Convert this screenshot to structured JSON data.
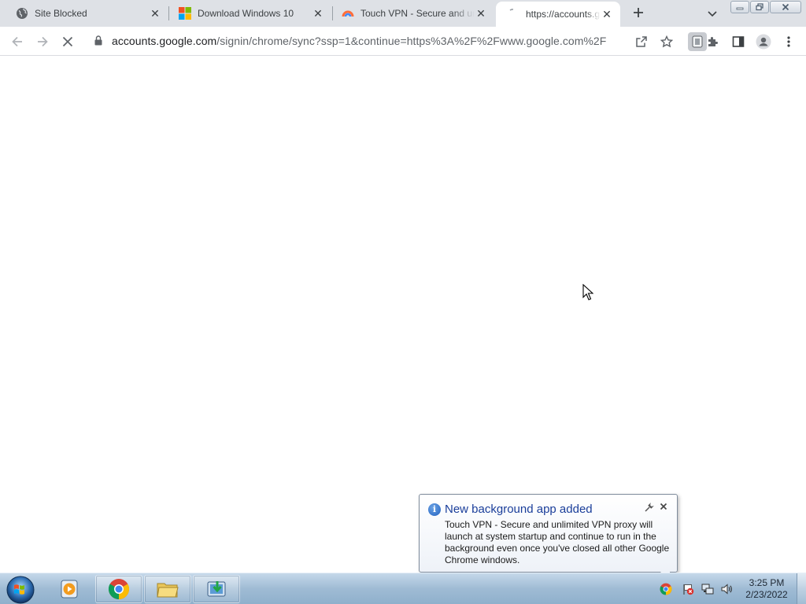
{
  "tabs": [
    {
      "title": "Site Blocked",
      "favicon": "globe-icon",
      "active": false
    },
    {
      "title": "Download Windows 10",
      "favicon": "windows-logo-icon",
      "active": false
    },
    {
      "title": "Touch VPN - Secure and unlimited VPN proxy",
      "favicon": "touch-vpn-icon",
      "active": false
    },
    {
      "title": "https://accounts.google.com/signin/chrome/sync",
      "favicon": "loading-spinner-icon",
      "active": true
    }
  ],
  "toolbar": {
    "url_host": "accounts.google.com",
    "url_path": "/signin/chrome/sync?ssp=1&continue=https%3A%2F%2Fwww.google.com%2F",
    "page_state": "loading"
  },
  "notification": {
    "title": "New background app added",
    "body": "Touch VPN - Secure and unlimited VPN proxy will launch at system startup and continue to run in the background even once you've closed all other Google Chrome windows."
  },
  "taskbar": {
    "apps": [
      {
        "name": "Windows Media Player",
        "icon": "media-player-icon",
        "pinned": false
      },
      {
        "name": "Google Chrome",
        "icon": "chrome-icon",
        "pinned": true
      },
      {
        "name": "Windows Explorer",
        "icon": "folder-icon",
        "pinned": true
      },
      {
        "name": "Download",
        "icon": "download-app-icon",
        "pinned": true
      }
    ],
    "time": "3:25 PM",
    "date": "2/23/2022"
  },
  "colors": {
    "tabstrip": "#dee1e6",
    "active_tab": "#ffffff",
    "balloon_title": "#1a3e9a",
    "taskbar": "#9fbbd4"
  }
}
